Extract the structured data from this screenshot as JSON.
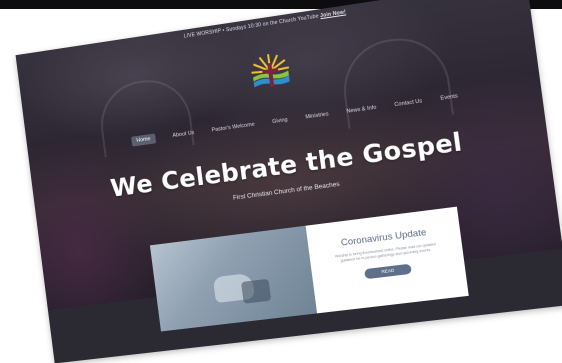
{
  "announcement": {
    "text": "LIVE WORSHIP • Sundays 10:30 on the Church YouTube",
    "link": "Join Now!"
  },
  "nav": {
    "items": [
      "Home",
      "About Us",
      "Pastor's Welcome",
      "Giving",
      "Ministries",
      "News & Info",
      "Contact Us",
      "Events"
    ]
  },
  "hero": {
    "title": "We Celebrate the Gospel",
    "subtitle": "First Christian Church of the Beaches"
  },
  "card": {
    "title": "Coronavirus Update",
    "text": "Worship is being livestreamed online. Please read our updated guidance for in-person gatherings and upcoming events.",
    "button": "READ"
  },
  "icons": {
    "search": "search-icon",
    "logo": "cross-sunrise-logo-icon"
  },
  "colors": {
    "accent": "#5d6f8a",
    "overlay": "#2b2a33"
  }
}
